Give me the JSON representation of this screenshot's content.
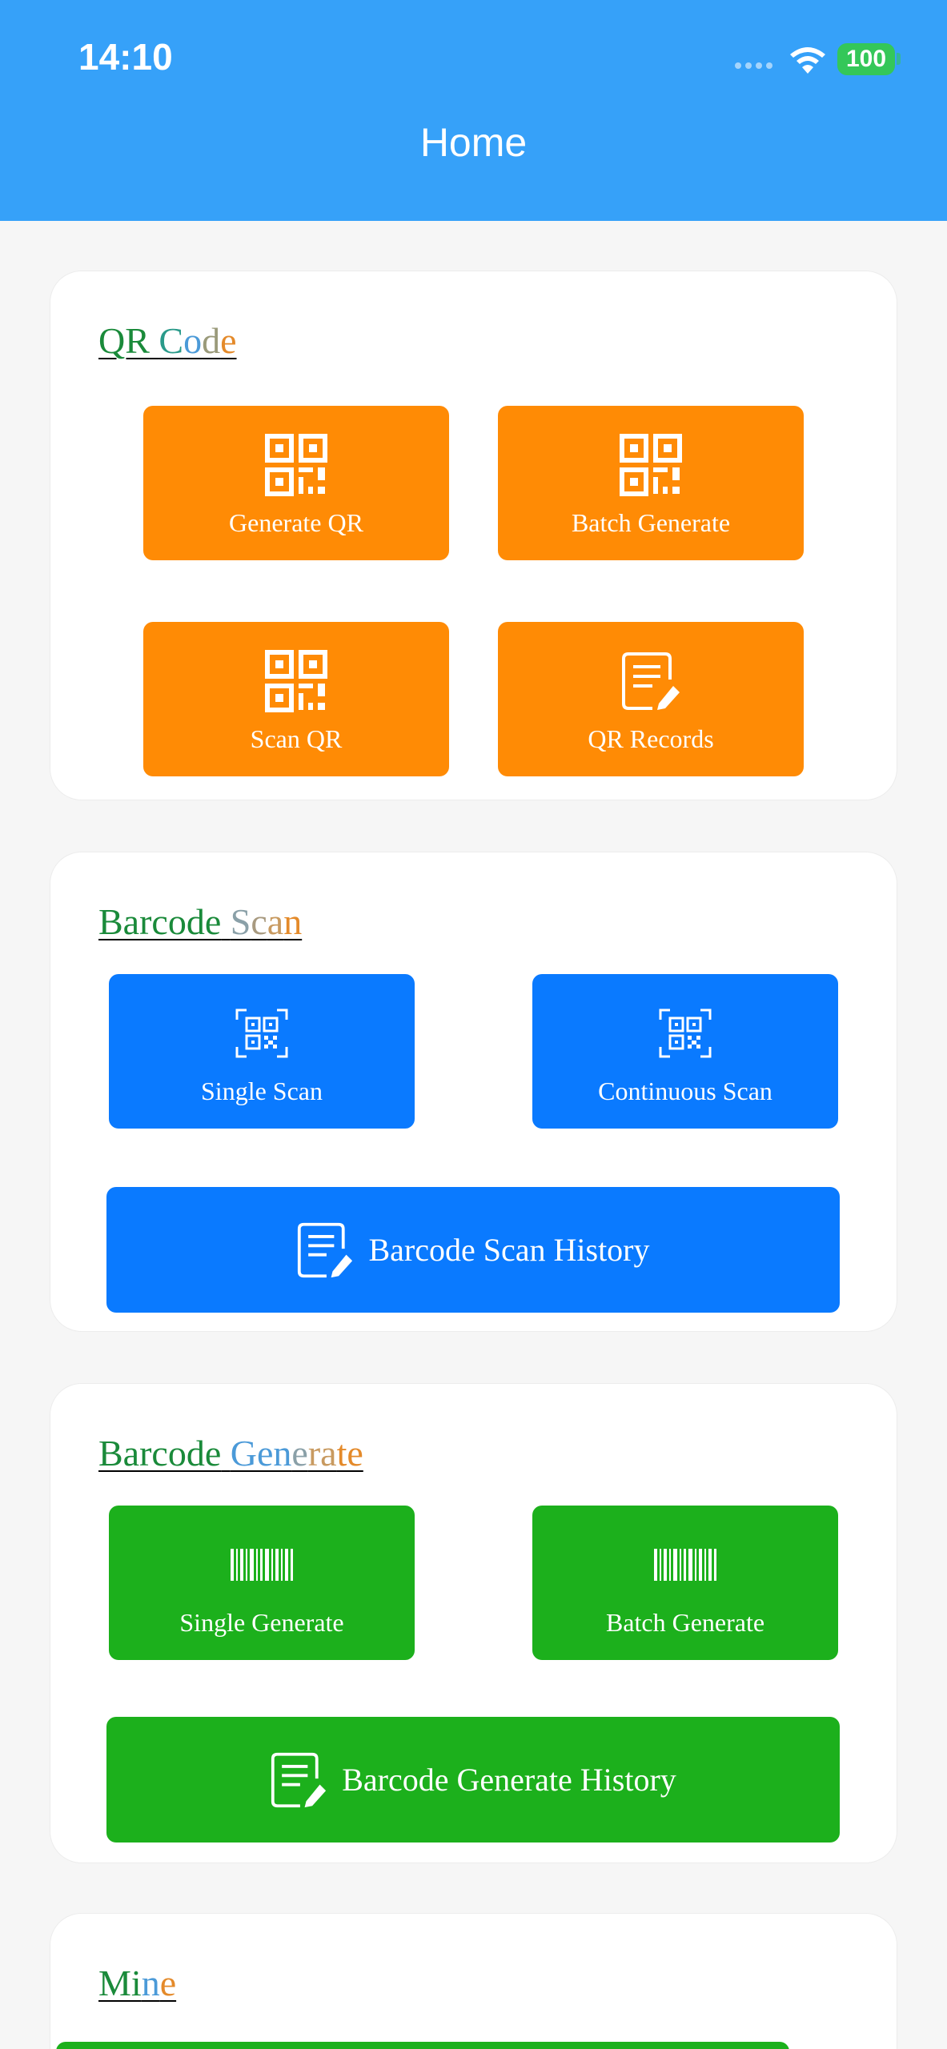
{
  "status": {
    "time": "14:10",
    "battery": "100"
  },
  "header": {
    "title": "Home"
  },
  "qr": {
    "title_parts": [
      "QR",
      " ",
      "C",
      "o",
      "d",
      "e"
    ],
    "tiles": [
      {
        "label": "Generate QR",
        "icon": "qr-code-icon"
      },
      {
        "label": "Batch Generate",
        "icon": "qr-code-icon"
      },
      {
        "label": "Scan QR",
        "icon": "qr-code-icon"
      },
      {
        "label": "QR Records",
        "icon": "document-edit-icon"
      }
    ]
  },
  "barcode_scan": {
    "title_parts": [
      "Barcode",
      " ",
      "S",
      "c",
      "a",
      "n"
    ],
    "tiles": [
      {
        "label": "Single Scan",
        "icon": "qr-scan-icon"
      },
      {
        "label": "Continuous Scan",
        "icon": "qr-scan-icon"
      }
    ],
    "history_label": "Barcode Scan History"
  },
  "barcode_generate": {
    "title_parts": [
      "Barcode",
      " ",
      "Gen",
      "e",
      "ra",
      "te"
    ],
    "tiles": [
      {
        "label": "Single Generate",
        "icon": "barcode-icon"
      },
      {
        "label": "Batch Generate",
        "icon": "barcode-icon"
      }
    ],
    "history_label": "Barcode Generate History"
  },
  "mine": {
    "title_parts": [
      "Mi",
      "n",
      "e"
    ]
  },
  "colors": {
    "header": "#36a1f9",
    "orange": "#ff8b05",
    "blue": "#0a7aff",
    "green": "#1cb01c",
    "title_green": "#1a8a3a",
    "title_blue": "#4b9ad8",
    "title_orange": "#e48a2a"
  }
}
